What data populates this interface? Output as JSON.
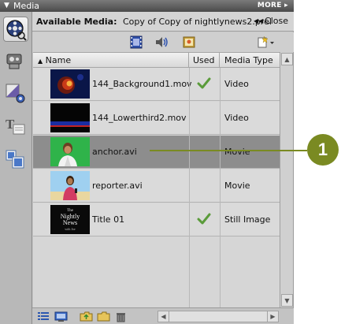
{
  "panel": {
    "title": "Media",
    "more_label": "MORE",
    "collapse_icon": "triangle-down-icon",
    "more_icon": "triangle-right-icon"
  },
  "header": {
    "label": "Available Media:",
    "value": "Copy of Copy of nightlynews2.prel",
    "close_label": "Close"
  },
  "toolbar": {
    "icons": [
      "film-strip-icon",
      "speaker-icon",
      "image-icon",
      "new-item-icon"
    ]
  },
  "table": {
    "columns": [
      "Name",
      "Used",
      "Media Type"
    ],
    "rows": [
      {
        "name": "144_Background1.mov",
        "used": true,
        "type": "Video",
        "thumb": "fire-thumbnail"
      },
      {
        "name": "144_Lowerthird2.mov",
        "used": false,
        "type": "Video",
        "thumb": "lowerthird-thumbnail"
      },
      {
        "name": "anchor.avi",
        "used": false,
        "type": "Movie",
        "thumb": "anchor-thumbnail",
        "selected": true
      },
      {
        "name": "reporter.avi",
        "used": false,
        "type": "Movie",
        "thumb": "reporter-thumbnail"
      },
      {
        "name": "Title 01",
        "used": true,
        "type": "Still Image",
        "thumb": "title-thumbnail"
      }
    ],
    "thumb_title_lines": [
      "The",
      "Nightly",
      "News",
      "with Joe"
    ]
  },
  "sidebar": {
    "icons": [
      "media-reel-icon",
      "effects-icon",
      "transitions-icon",
      "titles-icon",
      "themes-icon"
    ]
  },
  "bottombar": {
    "icons": [
      "list-view-icon",
      "icon-view-icon",
      "folder-up-icon",
      "new-folder-icon",
      "trash-icon"
    ]
  },
  "callout": {
    "label": "1"
  },
  "colors": {
    "callout": "#7a8a22",
    "selected_row": "#8d8d8d",
    "check": "#5a9b3a"
  }
}
